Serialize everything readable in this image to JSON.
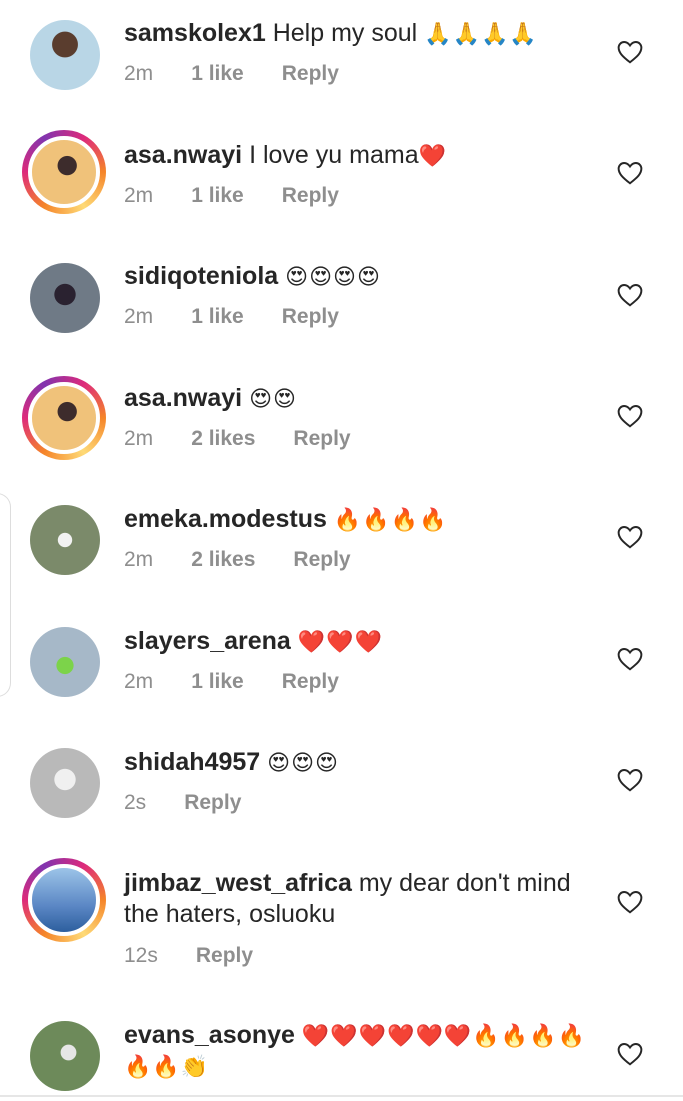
{
  "comments": [
    {
      "username": "samskolex1",
      "text": " Help my soul ",
      "emoji": "🙏🙏🙏🙏",
      "time": "2m",
      "likes": "1 like",
      "reply": "Reply",
      "avatar_color": "#8fa5a0"
    },
    {
      "username": "asa.nwayi",
      "text": " I love yu mama",
      "emoji": "❤️",
      "time": "2m",
      "likes": "1 like",
      "reply": "Reply",
      "avatar_color": "#e6b35a"
    },
    {
      "username": "sidiqoteniola",
      "text": " ",
      "emoji": "😍😍😍😍",
      "time": "2m",
      "likes": "1 like",
      "reply": "Reply",
      "avatar_color": "#6f7a86"
    },
    {
      "username": "asa.nwayi",
      "text": " ",
      "emoji": "😍😍",
      "time": "2m",
      "likes": "2 likes",
      "reply": "Reply",
      "avatar_color": "#e6b35a"
    },
    {
      "username": "emeka.modestus",
      "text": " ",
      "emoji": "🔥🔥🔥🔥",
      "time": "2m",
      "likes": "2 likes",
      "reply": "Reply",
      "avatar_color": "#7b8a6a"
    },
    {
      "username": "slayers_arena",
      "text": " ",
      "emoji": "❤️❤️❤️",
      "time": "2m",
      "likes": "1 like",
      "reply": "Reply",
      "avatar_color": "#a6b8c8"
    },
    {
      "username": "shidah4957",
      "text": " ",
      "emoji": "😍😍😍",
      "time": "2s",
      "likes": "",
      "reply": "Reply",
      "avatar_color": "#b9b9b9"
    },
    {
      "username": "jimbaz_west_africa",
      "text": " my dear don't mind the haters, osluoku",
      "emoji": "",
      "time": "12s",
      "likes": "",
      "reply": "Reply",
      "avatar_color": "#5a86c4"
    },
    {
      "username": "evans_asonye",
      "text": " ",
      "emoji": "❤️❤️❤️❤️❤️❤️🔥🔥🔥🔥🔥🔥👏",
      "time": "",
      "likes": "",
      "reply": "",
      "avatar_color": "#6d8a5a"
    }
  ],
  "icons": {
    "like": "heart-outline-icon"
  }
}
